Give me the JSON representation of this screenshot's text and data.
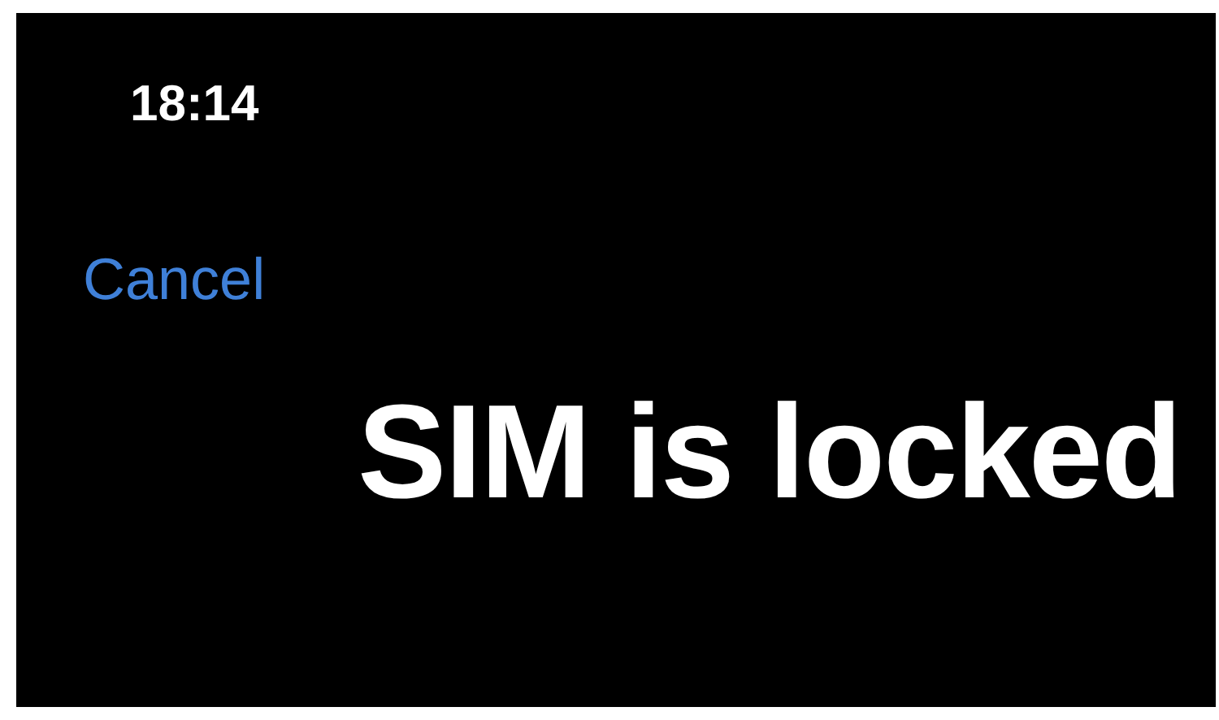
{
  "status_bar": {
    "time": "18:14"
  },
  "nav": {
    "cancel": "Cancel"
  },
  "title": "SIM is locked"
}
